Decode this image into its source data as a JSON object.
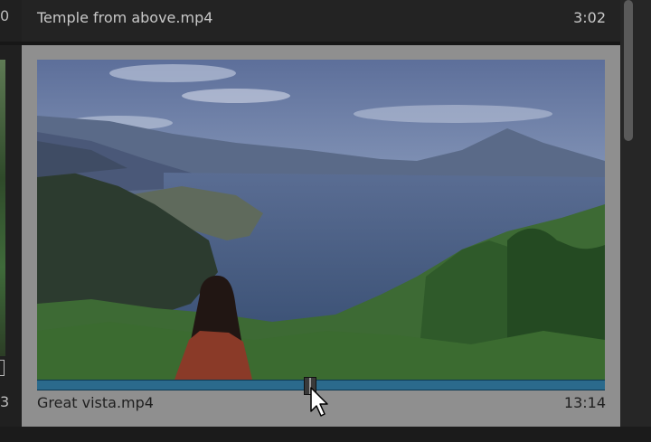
{
  "top_clip": {
    "title": "Temple from above.mp4",
    "duration": "3:02"
  },
  "selected_clip": {
    "title": "Great vista.mp4",
    "duration": "13:14",
    "playhead_fraction": 0.48
  },
  "left_partial": {
    "top_text": "0",
    "bottom_text": "3"
  },
  "colors": {
    "scrub_bar": "#2b6a8c",
    "card_bg": "#8f8f8f",
    "panel_bg": "#1d1d1d"
  },
  "icons": [
    "mouse-pointer-icon"
  ]
}
